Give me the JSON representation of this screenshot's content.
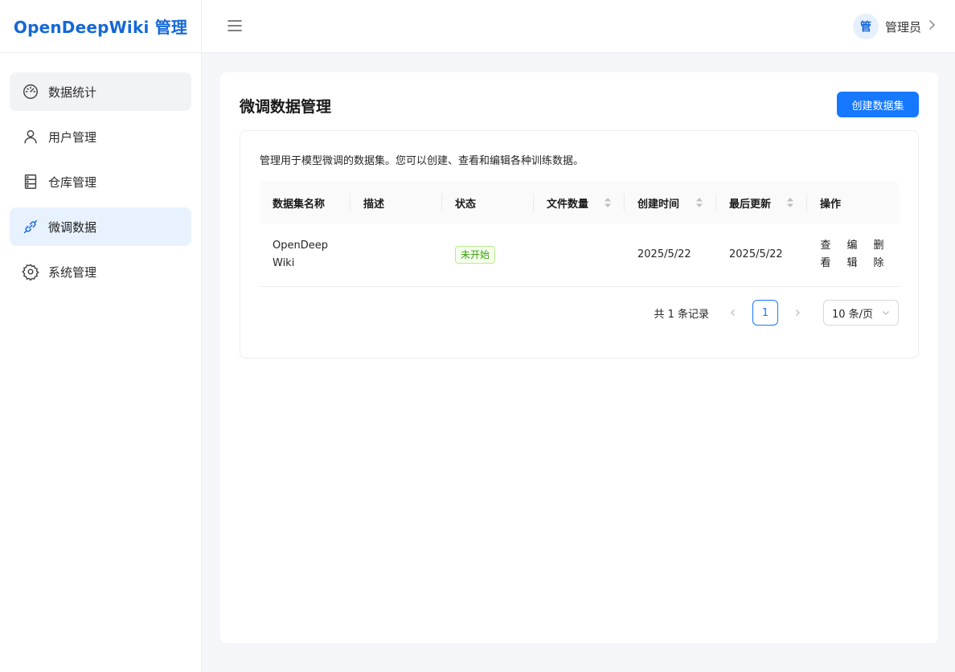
{
  "app": {
    "title": "OpenDeepWiki 管理"
  },
  "sidebar": {
    "items": [
      {
        "label": "数据统计",
        "icon": "dashboard-icon"
      },
      {
        "label": "用户管理",
        "icon": "user-icon"
      },
      {
        "label": "仓库管理",
        "icon": "database-icon"
      },
      {
        "label": "微调数据",
        "icon": "link-icon"
      },
      {
        "label": "系统管理",
        "icon": "gear-icon"
      }
    ],
    "active_index": 3,
    "hover_index": 0
  },
  "header": {
    "menu_icon": "hamburger-icon",
    "avatar_text": "管",
    "user_name": "管理员",
    "chevron_icon": "chevron-right-icon"
  },
  "main": {
    "title": "微调数据管理",
    "create_button": "创建数据集",
    "description": "管理用于模型微调的数据集。您可以创建、查看和编辑各种训练数据。",
    "table": {
      "columns": [
        "数据集名称",
        "描述",
        "状态",
        "文件数量",
        "创建时间",
        "最后更新",
        "操作"
      ],
      "rows": [
        {
          "name": "OpenDeepWiki",
          "description": "",
          "status": "未开始",
          "file_count": "",
          "created": "2025/5/22",
          "updated": "2025/5/22",
          "actions": [
            "查看",
            "编辑",
            "删除"
          ]
        }
      ]
    },
    "pagination": {
      "total": "共 1 条记录",
      "current_page": "1",
      "page_size": "10 条/页"
    }
  },
  "colors": {
    "brand": "#1468d8",
    "primary": "#1677ff",
    "active_bg": "#e8f2ff",
    "tag_green": "#389e0d"
  }
}
